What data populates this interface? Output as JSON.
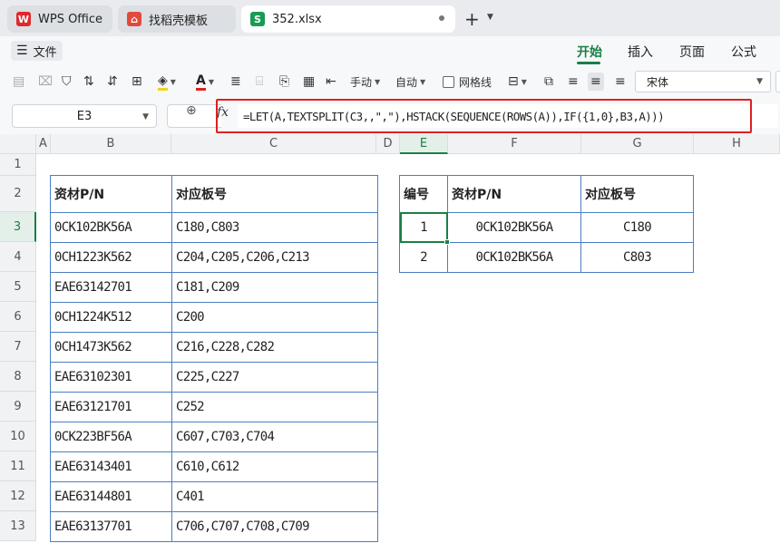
{
  "tabs": [
    {
      "label": "WPS Office",
      "icon": "wps-logo-icon",
      "color": "#e0282e"
    },
    {
      "label": "找稻壳模板",
      "icon": "docer-logo-icon",
      "color": "#e24a3b"
    },
    {
      "label": "352.xlsx",
      "icon": "spreadsheet-s-icon",
      "icon_text": "S",
      "color": "#1a9a52"
    }
  ],
  "menu": {
    "toggle_label": "文件",
    "tabs": [
      "开始",
      "插入",
      "页面",
      "公式"
    ],
    "active": "开始"
  },
  "toolbar": {
    "manual_label": "手动",
    "auto_label": "自动",
    "wrap_label": "网格线",
    "font_name": "宋体"
  },
  "formula_bar": {
    "name_box": "E3",
    "fx": "fx",
    "formula": "=LET(A,TEXTSPLIT(C3,,\",\"),HSTACK(SEQUENCE(ROWS(A)),IF({1,0},B3,A)))"
  },
  "sheet": {
    "columns": [
      "A",
      "B",
      "C",
      "D",
      "E",
      "F",
      "G",
      "H"
    ],
    "selected_column": "E",
    "rows": [
      "1",
      "2",
      "3",
      "4",
      "5",
      "6",
      "7",
      "8",
      "9",
      "10",
      "11",
      "12",
      "13"
    ],
    "selected_row": "3",
    "left_table": {
      "headers": [
        "资材P/N",
        "对应板号"
      ],
      "rows": [
        [
          "0CK102BK56A",
          "C180,C803"
        ],
        [
          "0CH1223K562",
          "C204,C205,C206,C213"
        ],
        [
          "EAE63142701",
          "C181,C209"
        ],
        [
          "0CH1224K512",
          "C200"
        ],
        [
          "0CH1473K562",
          "C216,C228,C282"
        ],
        [
          "EAE63102301",
          "C225,C227"
        ],
        [
          "EAE63121701",
          "C252"
        ],
        [
          "0CK223BF56A",
          "C607,C703,C704"
        ],
        [
          "EAE63143401",
          "C610,C612"
        ],
        [
          "EAE63144801",
          "C401"
        ],
        [
          "EAE63137701",
          "C706,C707,C708,C709"
        ]
      ]
    },
    "right_table": {
      "headers": [
        "编号",
        "资材P/N",
        "对应板号"
      ],
      "rows": [
        [
          "1",
          "0CK102BK56A",
          "C180"
        ],
        [
          "2",
          "0CK102BK56A",
          "C803"
        ]
      ]
    }
  },
  "colors": {
    "accent": "#1a7f46",
    "table_border": "#4a7fc0",
    "highlight": "#e02020"
  }
}
